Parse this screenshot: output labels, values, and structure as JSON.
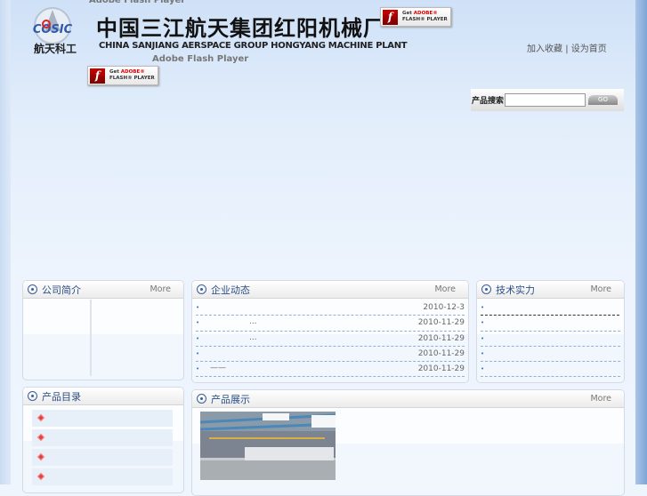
{
  "header": {
    "logo_text": "COSIC",
    "logo_caption": "航天科工",
    "title_cn": "中国三江航天集团红阳机械厂",
    "title_en": "CHINA SANJIANG AERSPACE GROUP HONGYANG MACHINE PLANT",
    "flash_label": "Adobe Flash Player",
    "flash_button": {
      "get": "Get",
      "adobe": "ADOBE®",
      "player": "FLASH® PLAYER"
    },
    "links": [
      "加入收藏",
      "设为首页"
    ],
    "link_sep": "|"
  },
  "search": {
    "label": "产品搜索",
    "value": "",
    "button": "GO"
  },
  "panels": {
    "about": {
      "title": "公司简介",
      "more": "More"
    },
    "news": {
      "title": "企业动态",
      "more": "More",
      "items": [
        {
          "text": "",
          "date": "2010-12-3"
        },
        {
          "text": "...",
          "date": "2010-11-29"
        },
        {
          "text": "...",
          "date": "2010-11-29"
        },
        {
          "text": "",
          "date": "2010-11-29"
        },
        {
          "text": "——",
          "date": "2010-11-29"
        }
      ]
    },
    "tech": {
      "title": "技术实力",
      "more": "More",
      "items": [
        "",
        "",
        "",
        "",
        ""
      ]
    },
    "catalog": {
      "title": "产品目录",
      "items": [
        "",
        "",
        "",
        ""
      ]
    },
    "showcase": {
      "title": "产品展示",
      "more": "More"
    }
  },
  "bullet": "•"
}
